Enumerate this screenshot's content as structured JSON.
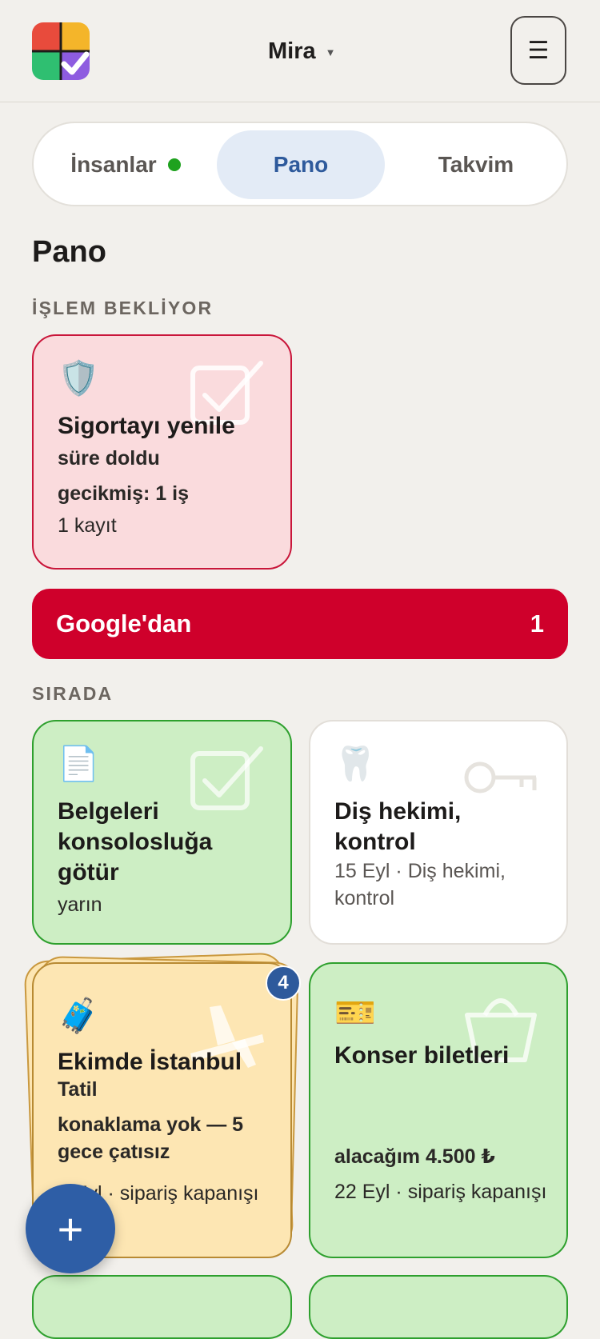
{
  "header": {
    "user_name": "Mira",
    "user_caret": "▼",
    "menu_icon": "☰"
  },
  "tabs": [
    {
      "label": "İnsanlar",
      "has_dot": true,
      "active": false
    },
    {
      "label": "Pano",
      "active": true
    },
    {
      "label": "Takvim",
      "active": false
    }
  ],
  "page_title": "Pano",
  "sections": {
    "pending": "İŞLEM BEKLİYOR",
    "queued": "SIRADA"
  },
  "pending_cards": [
    {
      "emoji": "🛡️",
      "title": "Sigortayı yenile",
      "lines": [
        "süre doldu",
        "gecikmiş: 1 iş",
        "1 kayıt"
      ],
      "watermark": "checkbox-icon",
      "color": "#fadbdd"
    }
  ],
  "google_bar": {
    "label": "Google'dan",
    "count": "1",
    "color": "#cf002b"
  },
  "queued_cards": [
    {
      "emoji": "📄",
      "title": "Belgeleri konsolosluğa götür",
      "lines": [
        "yarın"
      ],
      "watermark": "checkbox-icon"
    },
    {
      "emoji": "🦷",
      "title": "Diş hekimi, kontrol",
      "lines": [
        "15 Eyl · Diş hekimi, kontrol"
      ],
      "watermark": "key-icon"
    },
    {
      "emoji": "🧳",
      "title": "Ekimde İstanbul",
      "subtitle": "Tatil",
      "lines": [
        "konaklama yok — 5 gece çatısız",
        "1 Eyl · sipariş kapanışı"
      ],
      "stack_count": "4",
      "watermark": "airplane-icon"
    },
    {
      "emoji": "🎫",
      "title": "Konser biletleri",
      "lines": [
        "alacağım 4.500 ₺",
        "22 Eyl · sipariş kapanışı"
      ],
      "watermark": "basket-icon"
    }
  ],
  "fab": {
    "label": "+"
  },
  "colors": {
    "accent": "#2e5a9c",
    "green_card": "#cdeec4",
    "yellow_card": "#fde6b3",
    "red_card": "#fadbdd"
  }
}
